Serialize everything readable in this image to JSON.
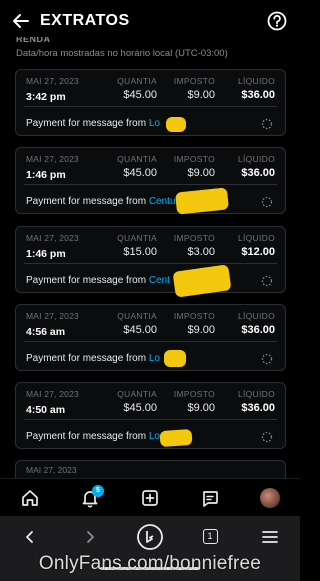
{
  "header": {
    "title": "EXTRATOS"
  },
  "section": {
    "cut_label": "RENDA",
    "tz_note": "Data/hora mostradas no horário local (UTC-03:00)"
  },
  "columns": {
    "amount": "QUANTIA",
    "tax": "IMPOSTO",
    "net": "LÍQUIDO"
  },
  "transactions": [
    {
      "date": "MAI 27, 2023",
      "time": "3:42 pm",
      "amount": "$45.00",
      "tax": "$9.00",
      "net": "$36.00",
      "desc_prefix": "Payment for message from ",
      "desc_link": "Lo"
    },
    {
      "date": "MAI 27, 2023",
      "time": "1:46 pm",
      "amount": "$45.00",
      "tax": "$9.00",
      "net": "$36.00",
      "desc_prefix": "Payment for message from ",
      "desc_link": "Centu"
    },
    {
      "date": "MAI 27, 2023",
      "time": "1:46 pm",
      "amount": "$15.00",
      "tax": "$3.00",
      "net": "$12.00",
      "desc_prefix": "Payment for message from ",
      "desc_link": "Cent"
    },
    {
      "date": "MAI 27, 2023",
      "time": "4:56 am",
      "amount": "$45.00",
      "tax": "$9.00",
      "net": "$36.00",
      "desc_prefix": "Payment for message from ",
      "desc_link": "Lo"
    },
    {
      "date": "MAI 27, 2023",
      "time": "4:50 am",
      "amount": "$45.00",
      "tax": "$9.00",
      "net": "$36.00",
      "desc_prefix": "Payment for message from ",
      "desc_link": "Lo"
    }
  ],
  "peek_date": "MAI 27, 2023",
  "nav": {
    "notification_count": "5"
  },
  "browser": {
    "tab_count": "1"
  },
  "watermark": "OnlyFans.com/bonniefree",
  "colors": {
    "accent": "#00aff0",
    "redaction": "#f2c70e",
    "background": "#000000"
  },
  "icons": [
    "back-arrow-icon",
    "help-icon",
    "home-icon",
    "bell-icon",
    "plus-square-icon",
    "chat-icon",
    "avatar",
    "chevron-left-icon",
    "chevron-right-icon",
    "bing-icon",
    "tabs-icon",
    "menu-icon",
    "spinner-icon"
  ]
}
